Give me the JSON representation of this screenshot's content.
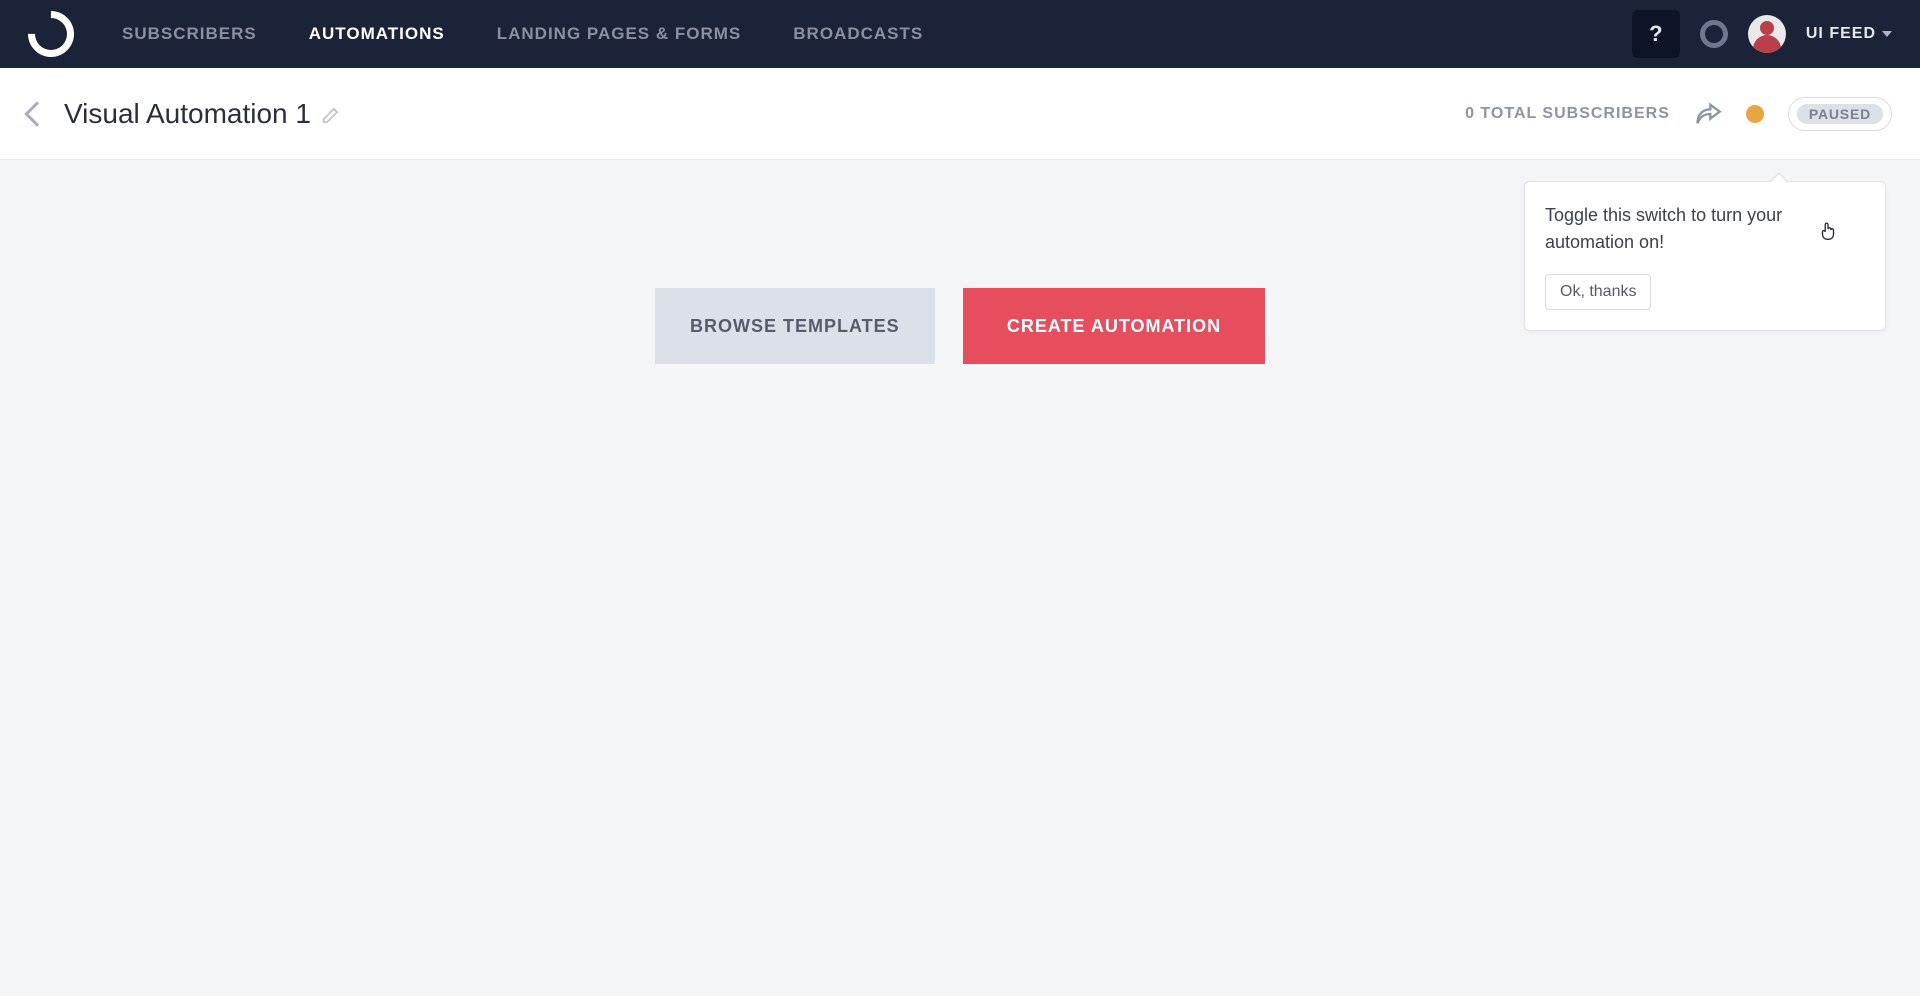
{
  "nav": {
    "items": [
      {
        "label": "SUBSCRIBERS"
      },
      {
        "label": "AUTOMATIONS"
      },
      {
        "label": "LANDING PAGES & FORMS"
      },
      {
        "label": "BROADCASTS"
      }
    ],
    "help": "?",
    "user": "UI FEED"
  },
  "secondary": {
    "title": "Visual Automation 1",
    "total_label": "0 TOTAL SUBSCRIBERS",
    "paused_label": "PAUSED"
  },
  "tooltip": {
    "text": "Toggle this switch to turn your automation on!",
    "ok": "Ok, thanks"
  },
  "cta": {
    "browse": "BROWSE TEMPLATES",
    "create": "CREATE AUTOMATION"
  }
}
